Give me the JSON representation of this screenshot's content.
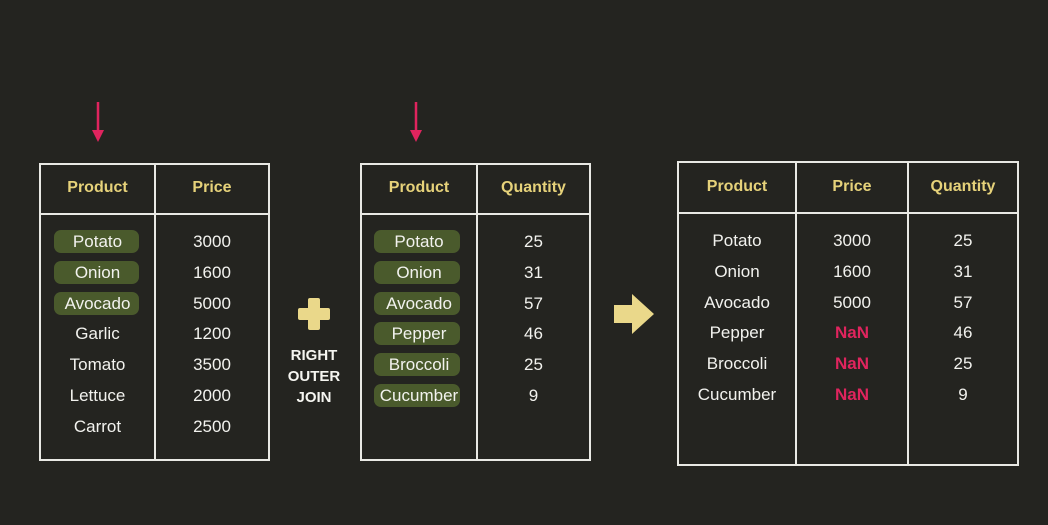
{
  "left_table": {
    "headers": [
      "Product",
      "Price"
    ],
    "rows": [
      {
        "product": "Potato",
        "price": "3000",
        "matched": true
      },
      {
        "product": "Onion",
        "price": "1600",
        "matched": true
      },
      {
        "product": "Avocado",
        "price": "5000",
        "matched": true
      },
      {
        "product": "Garlic",
        "price": "1200",
        "matched": false
      },
      {
        "product": "Tomato",
        "price": "3500",
        "matched": false
      },
      {
        "product": "Lettuce",
        "price": "2000",
        "matched": false
      },
      {
        "product": "Carrot",
        "price": "2500",
        "matched": false
      }
    ]
  },
  "right_table": {
    "headers": [
      "Product",
      "Quantity"
    ],
    "rows": [
      {
        "product": "Potato",
        "quantity": "25",
        "matched": true
      },
      {
        "product": "Onion",
        "quantity": "31",
        "matched": true
      },
      {
        "product": "Avocado",
        "quantity": "57",
        "matched": true
      },
      {
        "product": "Pepper",
        "quantity": "46",
        "matched": true
      },
      {
        "product": "Broccoli",
        "quantity": "25",
        "matched": true
      },
      {
        "product": "Cucumber",
        "quantity": "9",
        "matched": true
      }
    ]
  },
  "operator": {
    "label_lines": [
      "RIGHT",
      "OUTER",
      "JOIN"
    ]
  },
  "result_table": {
    "headers": [
      "Product",
      "Price",
      "Quantity"
    ],
    "rows": [
      {
        "product": "Potato",
        "price": "3000",
        "quantity": "25",
        "price_missing": false
      },
      {
        "product": "Onion",
        "price": "1600",
        "quantity": "31",
        "price_missing": false
      },
      {
        "product": "Avocado",
        "price": "5000",
        "quantity": "57",
        "price_missing": false
      },
      {
        "product": "Pepper",
        "price": "NaN",
        "quantity": "46",
        "price_missing": true
      },
      {
        "product": "Broccoli",
        "price": "NaN",
        "quantity": "25",
        "price_missing": true
      },
      {
        "product": "Cucumber",
        "price": "NaN",
        "quantity": "9",
        "price_missing": true
      }
    ]
  },
  "colors": {
    "background": "#242420",
    "header_text": "#e6d27a",
    "highlight_pill": "#4a5a2c",
    "missing_value": "#e0245e",
    "key_arrow": "#e0245e",
    "operator_shapes": "#ead88a"
  },
  "icons": {
    "key_arrow": "arrow-down-icon",
    "operator": "plus-icon",
    "result_arrow": "arrow-right-icon"
  }
}
